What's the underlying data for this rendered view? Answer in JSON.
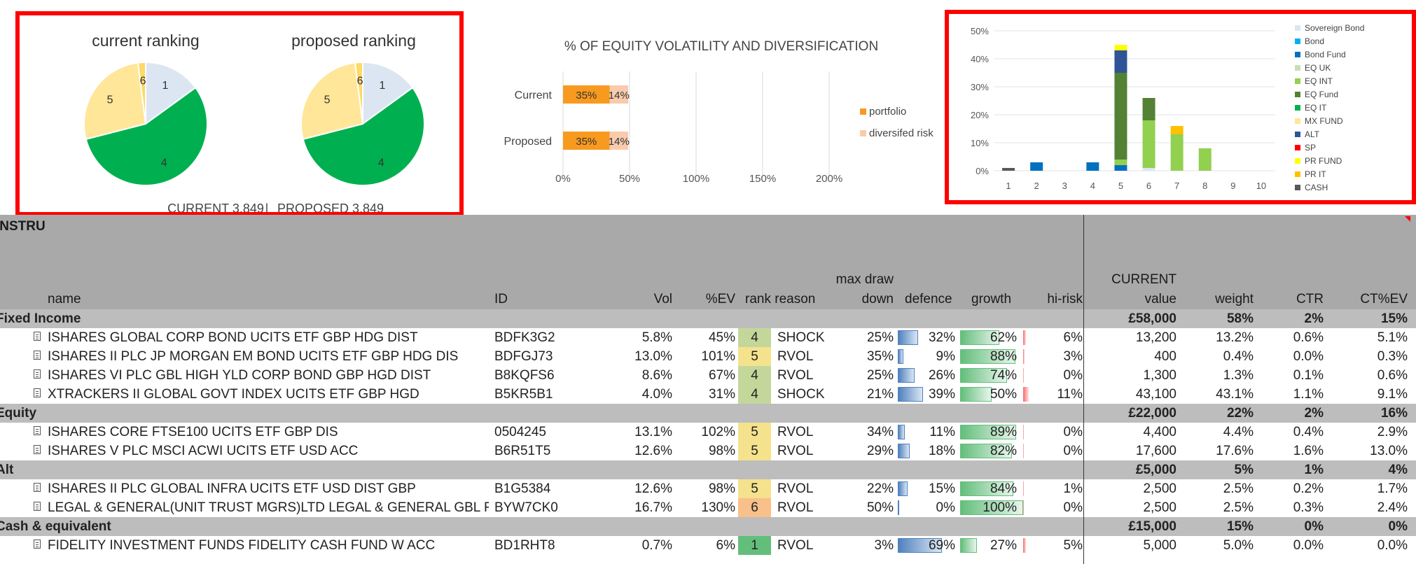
{
  "ranking_panel": {
    "current_title": "current ranking",
    "proposed_title": "proposed ranking",
    "current_caption": "CURRENT 3.849",
    "separator": "|",
    "proposed_caption": "PROPOSED 3.849"
  },
  "chart_data": [
    {
      "type": "pie",
      "title": "current ranking",
      "labels": [
        "1",
        "4",
        "5",
        "6"
      ],
      "values": [
        15,
        56,
        27,
        2
      ],
      "colors": [
        "#dce6f2",
        "#00b050",
        "#ffe699",
        "#ffd966"
      ],
      "legend": "none"
    },
    {
      "type": "pie",
      "title": "proposed ranking",
      "labels": [
        "1",
        "4",
        "5",
        "6"
      ],
      "values": [
        15,
        56,
        27,
        2
      ],
      "colors": [
        "#dce6f2",
        "#00b050",
        "#ffe699",
        "#ffd966"
      ],
      "legend": "none"
    },
    {
      "type": "bar",
      "orientation": "horizontal",
      "stacked": true,
      "title": "% OF EQUITY VOLATILITY AND DIVERSIFICATION",
      "categories": [
        "Current",
        "Proposed"
      ],
      "series": [
        {
          "name": "portfolio",
          "values": [
            35,
            35
          ],
          "color": "#f79a1f"
        },
        {
          "name": "diversifed risk",
          "values": [
            14,
            14
          ],
          "color": "#f8cbad"
        }
      ],
      "data_labels": [
        [
          "35%",
          "14%"
        ],
        [
          "35%",
          "14%"
        ]
      ],
      "x_ticks": [
        "0%",
        "50%",
        "100%",
        "150%",
        "200%"
      ],
      "xlim": [
        0,
        200
      ],
      "grid": true,
      "legend": "right"
    },
    {
      "type": "bar",
      "stacked": true,
      "categories": [
        "1",
        "2",
        "3",
        "4",
        "5",
        "6",
        "7",
        "8",
        "9",
        "10"
      ],
      "y_ticks": [
        "0%",
        "10%",
        "20%",
        "30%",
        "40%",
        "50%"
      ],
      "ylim": [
        0,
        50
      ],
      "grid": true,
      "legend": "right",
      "series": [
        {
          "name": "Sovereign Bond",
          "color": "#dce6f2",
          "values": [
            0,
            0,
            0,
            0,
            0,
            1,
            0,
            0,
            0,
            0
          ]
        },
        {
          "name": "Bond",
          "color": "#00b0f0",
          "values": [
            0,
            0,
            0,
            0,
            0,
            0,
            0,
            0,
            0,
            0
          ]
        },
        {
          "name": "Bond Fund",
          "color": "#0070c0",
          "values": [
            0,
            3,
            0,
            3,
            2,
            0,
            0,
            0,
            0,
            0
          ]
        },
        {
          "name": "EQ UK",
          "color": "#c6e0b4",
          "values": [
            0,
            0,
            0,
            0,
            0,
            0,
            0,
            0,
            0,
            0
          ]
        },
        {
          "name": "EQ INT",
          "color": "#92d050",
          "values": [
            0,
            0,
            0,
            0,
            2,
            17,
            13,
            8,
            0,
            0
          ]
        },
        {
          "name": "EQ Fund",
          "color": "#548235",
          "values": [
            0,
            0,
            0,
            0,
            31,
            8,
            0,
            0,
            0,
            0
          ]
        },
        {
          "name": "EQ IT",
          "color": "#00b050",
          "values": [
            0,
            0,
            0,
            0,
            0,
            0,
            0,
            0,
            0,
            0
          ]
        },
        {
          "name": "MX FUND",
          "color": "#ffe699",
          "values": [
            0,
            0,
            0,
            0,
            0,
            0,
            0,
            0,
            0,
            0
          ]
        },
        {
          "name": "ALT",
          "color": "#2f5597",
          "values": [
            0,
            0,
            0,
            0,
            8,
            0,
            0,
            0,
            0,
            0
          ]
        },
        {
          "name": "SP",
          "color": "#ff0000",
          "values": [
            0,
            0,
            0,
            0,
            0,
            0,
            0,
            0,
            0,
            0
          ]
        },
        {
          "name": "PR FUND",
          "color": "#ffff00",
          "values": [
            0,
            0,
            0,
            0,
            2,
            0,
            0,
            0,
            0,
            0
          ]
        },
        {
          "name": "PR IT",
          "color": "#ffc000",
          "values": [
            0,
            0,
            0,
            0,
            0,
            0,
            3,
            0,
            0,
            0
          ]
        },
        {
          "name": "CASH",
          "color": "#595959",
          "values": [
            1,
            0,
            0,
            0,
            0,
            0,
            0,
            0,
            0,
            0
          ]
        }
      ]
    }
  ],
  "table": {
    "corner_label": "INSTRUMENT",
    "headers": {
      "name": "name",
      "id": "ID",
      "vol": "Vol",
      "pev": "%EV",
      "rank_reason": "rank reason",
      "maxdraw_top": "max draw",
      "maxdraw_bottom": "down",
      "defence": "defence",
      "growth": "growth",
      "hirisk": "hi-risk",
      "current_top": "CURRENT",
      "current_bottom": "value",
      "weight": "weight",
      "ctr": "CTR",
      "ctev": "CT%EV"
    },
    "rows": [
      {
        "kind": "cat",
        "name": "Fixed Income",
        "value": "£58,000",
        "weight": "58%",
        "ctr": "2%",
        "ctev": "15%"
      },
      {
        "kind": "item",
        "name": "ISHARES GLOBAL CORP BOND UCITS ETF GBP HDG DIST",
        "id": "BDFK3G2",
        "vol": "5.8%",
        "pev": "45%",
        "rank": "4",
        "rank_color": "#c4d79b",
        "reason": "SHOCK",
        "maxdraw": "25%",
        "maxdraw_level": 25,
        "defence": "32%",
        "defence_level": 32,
        "growth": "62%",
        "growth_level": 62,
        "hirisk": "6%",
        "hirisk_level": 6,
        "value": "13,200",
        "weight": "13.2%",
        "ctr": "0.6%",
        "ctev": "5.1%"
      },
      {
        "kind": "item",
        "name": "ISHARES II PLC JP MORGAN EM BOND UCITS ETF GBP HDG DIS",
        "id": "BDFGJ73",
        "vol": "13.0%",
        "pev": "101%",
        "rank": "5",
        "rank_color": "#f5e28c",
        "reason": "RVOL",
        "maxdraw": "35%",
        "maxdraw_level": 35,
        "defence": "9%",
        "defence_level": 9,
        "growth": "88%",
        "growth_level": 88,
        "hirisk": "3%",
        "hirisk_level": 3,
        "value": "400",
        "weight": "0.4%",
        "ctr": "0.0%",
        "ctev": "0.3%"
      },
      {
        "kind": "item",
        "name": "ISHARES VI PLC GBL HIGH YLD CORP BOND GBP HGD DIST",
        "id": "B8KQFS6",
        "vol": "8.6%",
        "pev": "67%",
        "rank": "4",
        "rank_color": "#c4d79b",
        "reason": "RVOL",
        "maxdraw": "25%",
        "maxdraw_level": 25,
        "defence": "26%",
        "defence_level": 26,
        "growth": "74%",
        "growth_level": 74,
        "hirisk": "0%",
        "hirisk_level": 0,
        "value": "1,300",
        "weight": "1.3%",
        "ctr": "0.1%",
        "ctev": "0.6%"
      },
      {
        "kind": "item",
        "name": "XTRACKERS II GLOBAL GOVT INDEX UCITS ETF GBP HGD",
        "id": "B5KR5B1",
        "vol": "4.0%",
        "pev": "31%",
        "rank": "4",
        "rank_color": "#c4d79b",
        "reason": "SHOCK",
        "maxdraw": "21%",
        "maxdraw_level": 21,
        "defence": "39%",
        "defence_level": 39,
        "growth": "50%",
        "growth_level": 50,
        "hirisk": "11%",
        "hirisk_level": 11,
        "value": "43,100",
        "weight": "43.1%",
        "ctr": "1.1%",
        "ctev": "9.1%"
      },
      {
        "kind": "cat",
        "name": "Equity",
        "value": "£22,000",
        "weight": "22%",
        "ctr": "2%",
        "ctev": "16%"
      },
      {
        "kind": "item",
        "name": "ISHARES CORE FTSE100 UCITS ETF GBP DIS",
        "id": "0504245",
        "vol": "13.1%",
        "pev": "102%",
        "rank": "5",
        "rank_color": "#f5e28c",
        "reason": "RVOL",
        "maxdraw": "34%",
        "maxdraw_level": 34,
        "defence": "11%",
        "defence_level": 11,
        "growth": "89%",
        "growth_level": 89,
        "hirisk": "0%",
        "hirisk_level": 0,
        "value": "4,400",
        "weight": "4.4%",
        "ctr": "0.4%",
        "ctev": "2.9%"
      },
      {
        "kind": "item",
        "name": "ISHARES V PLC MSCI ACWI UCITS ETF USD ACC",
        "id": "B6R51T5",
        "vol": "12.6%",
        "pev": "98%",
        "rank": "5",
        "rank_color": "#f5e28c",
        "reason": "RVOL",
        "maxdraw": "29%",
        "maxdraw_level": 29,
        "defence": "18%",
        "defence_level": 18,
        "growth": "82%",
        "growth_level": 82,
        "hirisk": "0%",
        "hirisk_level": 0,
        "value": "17,600",
        "weight": "17.6%",
        "ctr": "1.6%",
        "ctev": "13.0%"
      },
      {
        "kind": "cat",
        "name": "Alt",
        "value": "£5,000",
        "weight": "5%",
        "ctr": "1%",
        "ctev": "4%"
      },
      {
        "kind": "item",
        "name": "ISHARES II PLC GLOBAL INFRA UCITS ETF USD DIST GBP",
        "id": "B1G5384",
        "vol": "12.6%",
        "pev": "98%",
        "rank": "5",
        "rank_color": "#f5e28c",
        "reason": "RVOL",
        "maxdraw": "22%",
        "maxdraw_level": 22,
        "defence": "15%",
        "defence_level": 15,
        "growth": "84%",
        "growth_level": 84,
        "hirisk": "1%",
        "hirisk_level": 1,
        "value": "2,500",
        "weight": "2.5%",
        "ctr": "0.2%",
        "ctev": "1.7%"
      },
      {
        "kind": "item",
        "name": "LEGAL & GENERAL(UNIT TRUST MGRS)LTD LEGAL & GENERAL GBL R/EST DIV",
        "id": "BYW7CK0",
        "vol": "16.7%",
        "pev": "130%",
        "rank": "6",
        "rank_color": "#f8c08a",
        "reason": "RVOL",
        "maxdraw": "50%",
        "maxdraw_level": 50,
        "defence": "0%",
        "defence_level": 0,
        "growth": "100%",
        "growth_level": 100,
        "hirisk": "0%",
        "hirisk_level": 0,
        "value": "2,500",
        "weight": "2.5%",
        "ctr": "0.3%",
        "ctev": "2.4%"
      },
      {
        "kind": "cat",
        "name": "Cash & equivalent",
        "value": "£15,000",
        "weight": "15%",
        "ctr": "0%",
        "ctev": "0%"
      },
      {
        "kind": "item",
        "name": "FIDELITY INVESTMENT FUNDS FIDELITY CASH FUND W ACC",
        "id": "BD1RHT8",
        "vol": "0.7%",
        "pev": "6%",
        "rank": "1",
        "rank_color": "#63be7b",
        "reason": "RVOL",
        "maxdraw": "3%",
        "maxdraw_level": 3,
        "defence": "69%",
        "defence_level": 69,
        "growth": "27%",
        "growth_level": 27,
        "hirisk": "5%",
        "hirisk_level": 5,
        "value": "5,000",
        "weight": "5.0%",
        "ctr": "0.0%",
        "ctev": "0.0%"
      }
    ]
  }
}
